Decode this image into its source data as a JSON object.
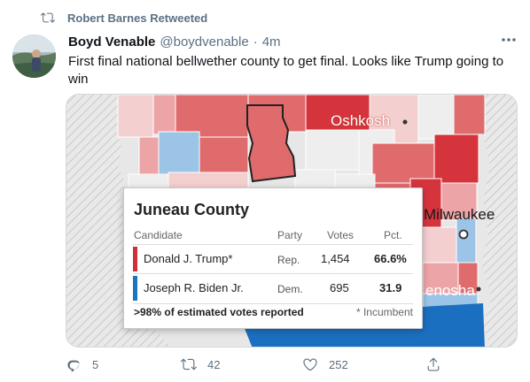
{
  "retweet_banner": {
    "text": "Robert Barnes Retweeted",
    "icon": "retweet-icon"
  },
  "tweet": {
    "author_name": "Boyd Venable",
    "handle": "@boydvenable",
    "separator": "·",
    "time": "4m",
    "text_line1": "First final national bellwether county to get final.  Looks like Trump going to",
    "text_line2": "win",
    "more_icon": "more-icon"
  },
  "media": {
    "labels": {
      "oshkosh": "Oshkosh",
      "milwaukee": "Milwaukee",
      "kenosha": "enosha"
    },
    "tooltip": {
      "county": "Juneau County",
      "headers": {
        "candidate": "Candidate",
        "party": "Party",
        "votes": "Votes",
        "pct": "Pct."
      },
      "rows": [
        {
          "candidate": "Donald J. Trump*",
          "party": "Rep.",
          "votes": "1,454",
          "pct": "66.6%",
          "color": "#d0303a"
        },
        {
          "candidate": "Joseph R. Biden Jr.",
          "party": "Dem.",
          "votes": "695",
          "pct": "31.9",
          "color": "#1b76c0"
        }
      ],
      "reported": ">98% of estimated votes reported",
      "incumbent_note": "* Incumbent"
    },
    "colors": {
      "rep_strong": "#d6343d",
      "rep_mid": "#e06b6d",
      "rep_light": "#eda4a6",
      "rep_pale": "#f4cfd0",
      "dem_light": "#9cc4e6",
      "dem_strong": "#1b6fc0",
      "neutral": "#e6e6e6"
    }
  },
  "actions": {
    "reply": {
      "count": "5",
      "icon": "reply-icon"
    },
    "retweet": {
      "count": "42",
      "icon": "retweet-icon"
    },
    "like": {
      "count": "252",
      "icon": "heart-icon"
    },
    "share": {
      "icon": "share-icon"
    }
  }
}
